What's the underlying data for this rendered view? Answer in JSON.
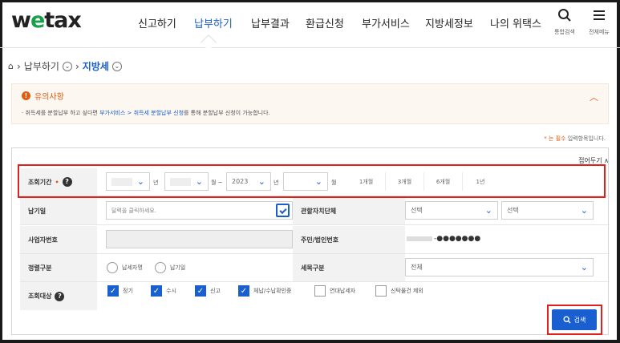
{
  "logo": {
    "text_a": "w",
    "text_o": "e",
    "text_b": "tax"
  },
  "nav": [
    {
      "label": "신고하기"
    },
    {
      "label": "납부하기"
    },
    {
      "label": "납부결과"
    },
    {
      "label": "환급신청"
    },
    {
      "label": "부가서비스"
    },
    {
      "label": "지방세정보"
    },
    {
      "label": "나의 위택스"
    }
  ],
  "util": {
    "search_label": "통합검색",
    "menu_label": "전체메뉴"
  },
  "breadcrumb": {
    "level1": "납부하기",
    "level2": "지방세"
  },
  "notice": {
    "title": "유의사항",
    "body_pre": "· 취득세를 분할납부 하고 싶다면 ",
    "body_link": "부가서비스 > 취득세 분할납부 신청",
    "body_post": "를 통해 분할납부 신청이 가능합니다."
  },
  "required_note": {
    "mark": "* 는 필수",
    "text": " 입력항목입니다."
  },
  "fold_label": "접어두기 ∧",
  "period": {
    "label": "조회기간",
    "year_unit_1": "년",
    "month_unit_1": "월 ~",
    "year_value_2": "2023",
    "year_unit_2": "년",
    "month_unit_2": "월",
    "quick": [
      "1개월",
      "3개월",
      "6개월",
      "1년"
    ]
  },
  "pay_date": {
    "label": "납기일",
    "placeholder": "달력을 클릭하세요."
  },
  "authority": {
    "label": "관할자치단체",
    "select1": "선택",
    "select2": "선택"
  },
  "biz_no": {
    "label": "사업자번호"
  },
  "rrn": {
    "label": "주민/법인번호",
    "value": "-●●●●●●●"
  },
  "sort": {
    "label": "정렬구분",
    "opt1": "납세자명",
    "opt2": "납기일"
  },
  "tax_item": {
    "label": "세목구분",
    "value": "전체"
  },
  "target": {
    "label": "조회대상",
    "options": [
      {
        "label": "정기",
        "checked": true
      },
      {
        "label": "수시",
        "checked": true
      },
      {
        "label": "신고",
        "checked": true
      },
      {
        "label": "체납/수납확인중",
        "checked": true
      },
      {
        "label": "연대납세자",
        "checked": false
      },
      {
        "label": "신탁물건 제외",
        "checked": false
      }
    ]
  },
  "search_button": "검색",
  "colors": {
    "brand_blue": "#1a5fcf",
    "brand_green": "#1aa04a",
    "alert_orange": "#e35a10",
    "highlight_red": "#e0201a"
  }
}
